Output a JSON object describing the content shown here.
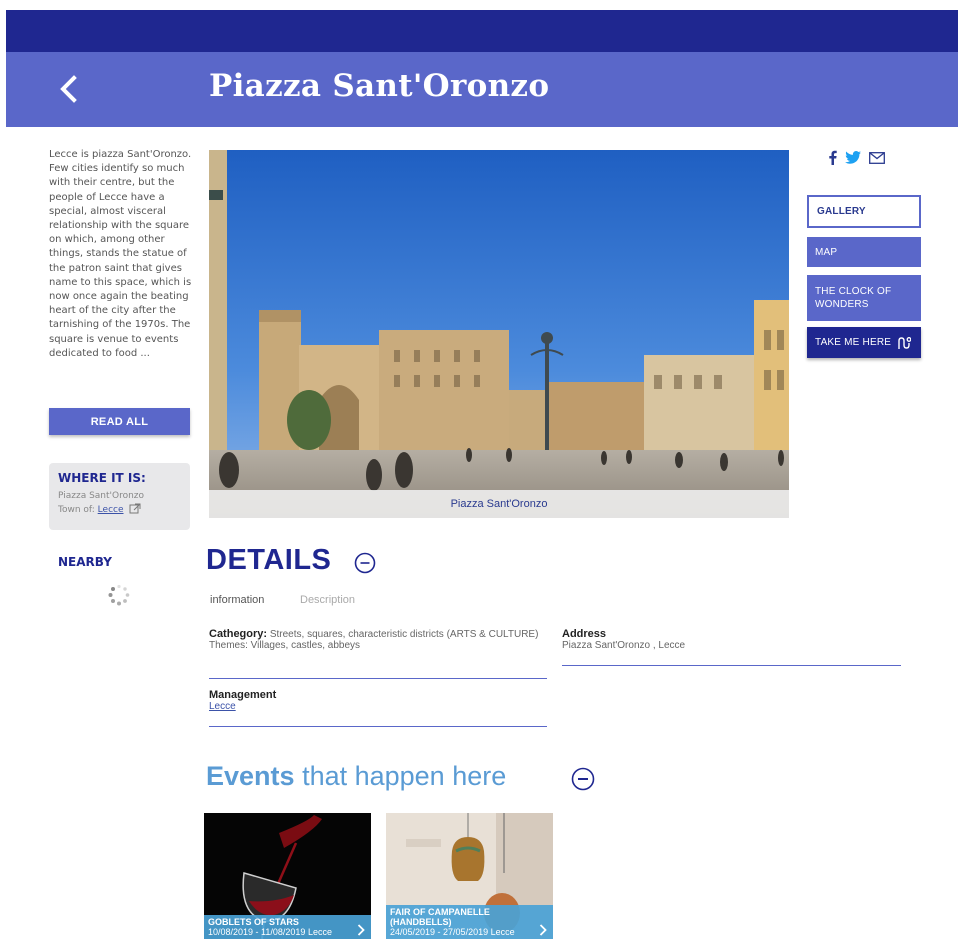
{
  "header": {
    "title": "Piazza Sant'Oronzo"
  },
  "intro": {
    "text": "Lecce is piazza Sant'Oronzo. Few cities identify so much with their centre, but the people of Lecce have a special, almost visceral relationship with the square on which, among other things, stands the statue of the patron saint that gives name to this space, which is now once again the beating heart of the city after the tarnishing of the 1970s. The square is venue to events dedicated to food ...",
    "read_all_label": "READ ALL"
  },
  "where": {
    "title": "WHERE IT IS:",
    "place": "Piazza Sant'Oronzo",
    "town_label": "Town of:",
    "town": "Lecce"
  },
  "nearby": {
    "title": "NEARBY"
  },
  "hero": {
    "caption": "Piazza Sant'Oronzo"
  },
  "side_buttons": {
    "gallery": "GALLERY",
    "map": "MAP",
    "clock": "THE CLOCK OF WONDERS",
    "take_me": "TAKE ME HERE"
  },
  "details": {
    "title": "DETAILS",
    "tabs": [
      "information",
      "Description"
    ],
    "category_label": "Cathegory:",
    "category_value": "Streets, squares, characteristic districts (ARTS & CULTURE)",
    "themes": "Themes: Villages, castles, abbeys",
    "address_label": "Address",
    "address_value": "Piazza Sant'Oronzo , Lecce",
    "management_label": "Management",
    "management_value": "Lecce"
  },
  "events": {
    "title_bold": "Events",
    "title_rest": "that happen here",
    "items": [
      {
        "title": "GOBLETS OF STARS",
        "dates": "10/08/2019 - 11/08/2019",
        "place": "Lecce"
      },
      {
        "title": "FAIR OF CAMPANELLE (HANDBELLS)",
        "dates": "24/05/2019 - 27/05/2019",
        "place": "Lecce"
      }
    ]
  },
  "colors": {
    "dark_blue": "#1f2790",
    "mid_blue": "#5a67c9",
    "light_blue": "#5a9bd4"
  },
  "icons": [
    "back-arrow-icon",
    "facebook-icon",
    "twitter-icon",
    "mail-icon",
    "external-link-icon",
    "loading-spinner-icon",
    "collapse-icon",
    "route-icon",
    "chevron-right-icon"
  ]
}
